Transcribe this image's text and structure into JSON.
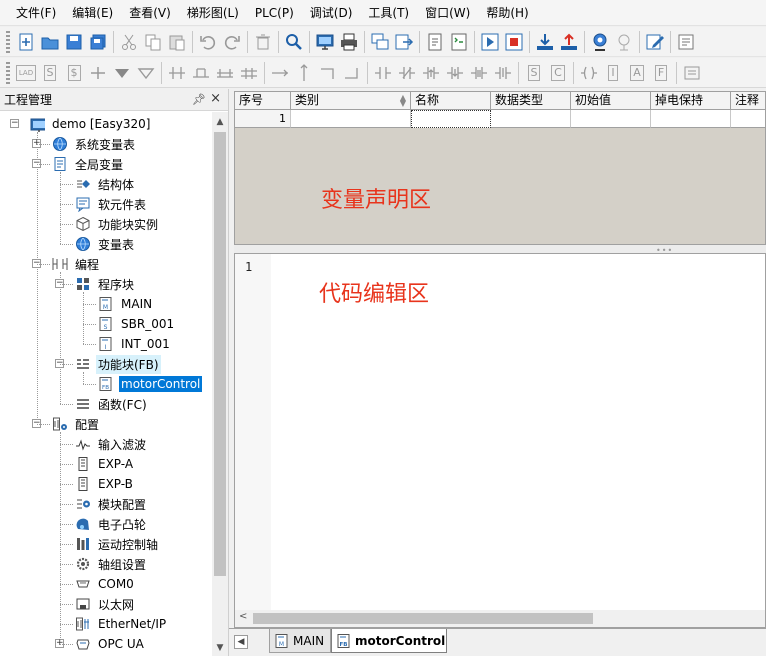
{
  "menu": [
    "文件(F)",
    "编辑(E)",
    "查看(V)",
    "梯形图(L)",
    "PLC(P)",
    "调试(D)",
    "工具(T)",
    "窗口(W)",
    "帮助(H)"
  ],
  "toolbar1": [
    {
      "name": "new-file-icon"
    },
    {
      "name": "open-folder-icon"
    },
    {
      "name": "save-icon"
    },
    {
      "name": "save-all-icon"
    },
    "sep",
    {
      "name": "cut-icon"
    },
    {
      "name": "copy-icon"
    },
    {
      "name": "paste-icon"
    },
    "sep",
    {
      "name": "undo-icon"
    },
    {
      "name": "redo-icon"
    },
    "sep",
    {
      "name": "delete-icon"
    },
    "sep",
    {
      "name": "search-icon"
    },
    "sep",
    {
      "name": "monitor-icon"
    },
    {
      "name": "print-icon"
    },
    "sep",
    {
      "name": "windows-icon"
    },
    {
      "name": "export-icon"
    },
    "sep",
    {
      "name": "compile-icon"
    },
    {
      "name": "compile-all-icon"
    },
    "sep",
    {
      "name": "run-icon"
    },
    {
      "name": "stop-icon"
    },
    "sep",
    {
      "name": "download-icon"
    },
    {
      "name": "upload-icon"
    },
    "sep",
    {
      "name": "webcam-icon"
    },
    {
      "name": "debug-disabled-icon"
    },
    "sep",
    {
      "name": "edit-icon"
    },
    "sep",
    {
      "name": "notes-icon"
    }
  ],
  "toolbar2": [
    {
      "name": "ladder-lad-icon",
      "text": "LAD"
    },
    {
      "name": "ladder-s-icon",
      "text": "S"
    },
    {
      "name": "ladder-dollar-icon",
      "text": "$"
    },
    {
      "name": "contact-cross-icon"
    },
    {
      "name": "arrow-down-filled-icon"
    },
    {
      "name": "arrow-down-outline-icon"
    },
    "sep",
    {
      "name": "branch-a-icon"
    },
    {
      "name": "branch-b-icon"
    },
    {
      "name": "branch-c-icon"
    },
    {
      "name": "branch-d-icon"
    },
    "sep",
    {
      "name": "line-horizontal-icon"
    },
    {
      "name": "line-vertical-icon"
    },
    {
      "name": "line-corner-a-icon"
    },
    {
      "name": "line-corner-b-icon"
    },
    "sep",
    {
      "name": "contact-no-icon"
    },
    {
      "name": "contact-nc-icon"
    },
    {
      "name": "contact-p-icon"
    },
    {
      "name": "contact-n-icon"
    },
    {
      "name": "contact-pn-icon"
    },
    {
      "name": "contact-nn-icon"
    },
    "sep",
    {
      "name": "func-s-icon",
      "text": "S"
    },
    {
      "name": "func-c-icon",
      "text": "C"
    },
    "sep",
    {
      "name": "coil-icon"
    },
    {
      "name": "coil-i-icon",
      "text": "I"
    },
    {
      "name": "func-a-icon",
      "text": "A"
    },
    {
      "name": "func-f-icon",
      "text": "F"
    },
    "sep",
    {
      "name": "comment-icon"
    }
  ],
  "panel": {
    "title": "工程管理",
    "pin": "ᵖ",
    "close": "×"
  },
  "tree": [
    {
      "label": "demo [Easy320]",
      "icon": "monitor-icon",
      "level": 0,
      "expander": "−"
    },
    {
      "label": "系统变量表",
      "icon": "globe-icon",
      "level": 1,
      "expander": "+"
    },
    {
      "label": "全局变量",
      "icon": "document-icon",
      "level": 1,
      "expander": "−"
    },
    {
      "label": "结构体",
      "icon": "struct-icon",
      "level": 2
    },
    {
      "label": "软元件表",
      "icon": "comment-box-icon",
      "level": 2
    },
    {
      "label": "功能块实例",
      "icon": "cube-icon",
      "level": 2
    },
    {
      "label": "变量表",
      "icon": "globe-icon",
      "level": 2
    },
    {
      "label": "编程",
      "icon": "ladder-rung-icon",
      "level": 1,
      "expander": "−"
    },
    {
      "label": "程序块",
      "icon": "grid-icon",
      "level": 2,
      "expander": "−"
    },
    {
      "label": "MAIN",
      "icon": "main-pou-icon",
      "level": 3
    },
    {
      "label": "SBR_001",
      "icon": "sbr-pou-icon",
      "level": 3
    },
    {
      "label": "INT_001",
      "icon": "int-pou-icon",
      "level": 3
    },
    {
      "label": "功能块(FB)",
      "icon": "fb-list-icon",
      "level": 2,
      "expander": "−",
      "highlight": true
    },
    {
      "label": "motorControl",
      "icon": "fb-pou-icon",
      "level": 3,
      "selected": true
    },
    {
      "label": "函数(FC)",
      "icon": "fc-list-icon",
      "level": 2
    },
    {
      "label": "配置",
      "icon": "config-icon",
      "level": 1,
      "expander": "−"
    },
    {
      "label": "输入滤波",
      "icon": "waveform-icon",
      "level": 2
    },
    {
      "label": "EXP-A",
      "icon": "module-icon",
      "level": 2
    },
    {
      "label": "EXP-B",
      "icon": "module-icon",
      "level": 2
    },
    {
      "label": "模块配置",
      "icon": "module-gear-icon",
      "level": 2
    },
    {
      "label": "电子凸轮",
      "icon": "cam-icon",
      "level": 2
    },
    {
      "label": "运动控制轴",
      "icon": "axis-icon",
      "level": 2
    },
    {
      "label": "轴组设置",
      "icon": "gear-icon",
      "level": 2
    },
    {
      "label": "COM0",
      "icon": "serial-port-icon",
      "level": 2
    },
    {
      "label": "以太网",
      "icon": "ethernet-icon",
      "level": 2
    },
    {
      "label": "EtherNet/IP",
      "icon": "ethernet-ip-icon",
      "level": 2
    },
    {
      "label": "OPC UA",
      "icon": "opcua-icon",
      "level": 2,
      "expander": "+"
    }
  ],
  "decl": {
    "columns": [
      "序号",
      "类别",
      "名称",
      "数据类型",
      "初始值",
      "掉电保持",
      "注释"
    ],
    "row_number": "1",
    "overlay_label": "变量声明区"
  },
  "code": {
    "line_number": "1",
    "overlay_label": "代码编辑区"
  },
  "tabs": [
    {
      "label": "MAIN",
      "icon": "main-pou-icon",
      "active": false
    },
    {
      "label": "motorControl",
      "icon": "fb-pou-icon",
      "active": true
    }
  ],
  "colors": {
    "accent": "#0078d7",
    "annotation": "#e8341c",
    "decl_bg": "#d4d0c8"
  }
}
